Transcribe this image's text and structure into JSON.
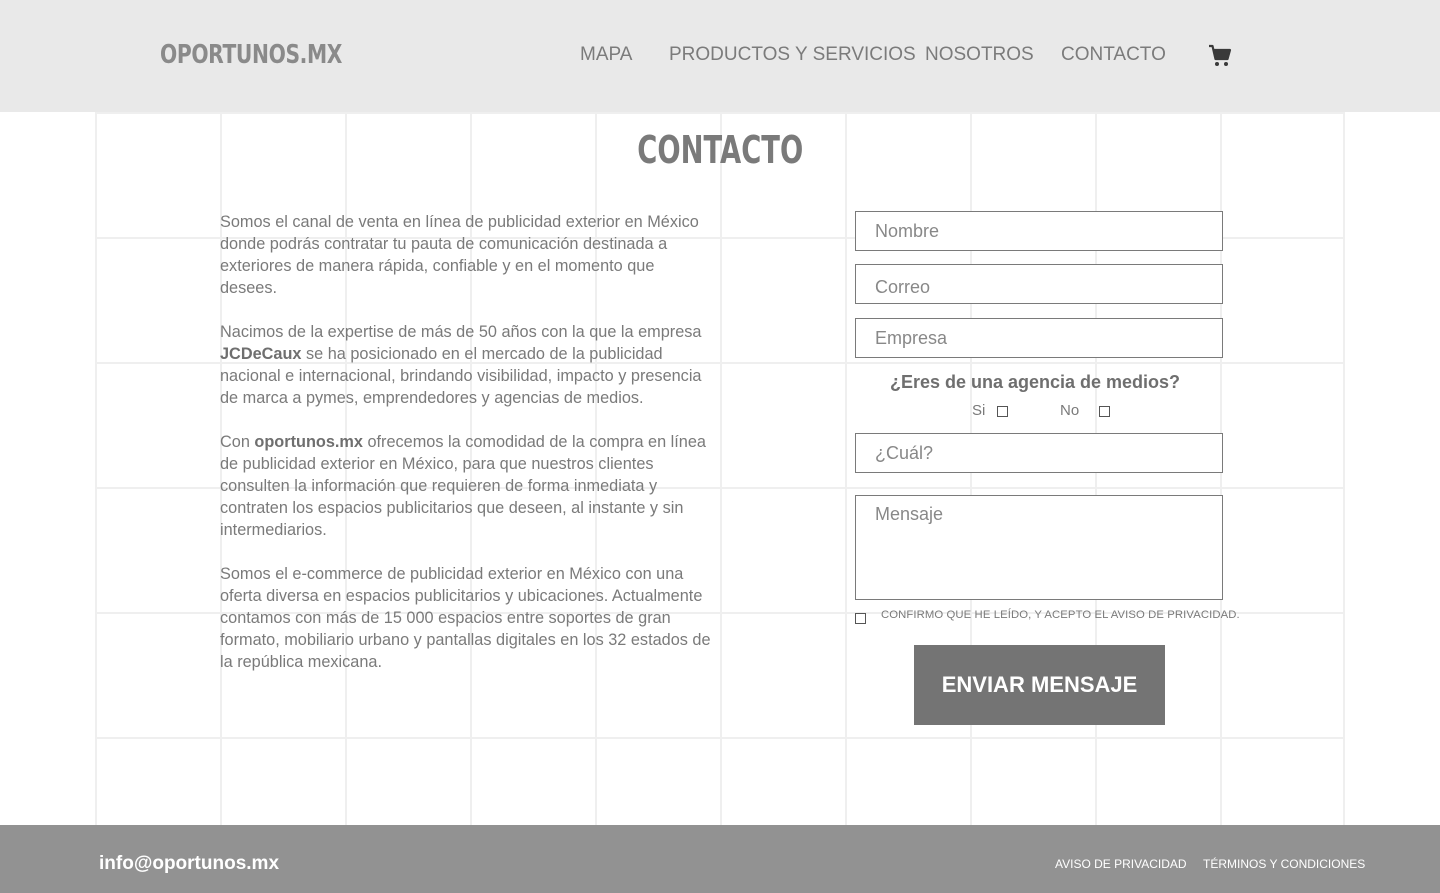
{
  "header": {
    "logo": "OPORTUNOS.MX",
    "nav": [
      "MAPA",
      "PRODUCTOS Y SERVICIOS",
      "NOSOTROS",
      "CONTACTO"
    ],
    "cart_icon": "shopping-cart-icon"
  },
  "page_title": "CONTACTO",
  "intro": {
    "p1": "Somos el canal de venta en línea de publicidad exterior en México donde podrás contratar tu pauta de comunicación destinada a exteriores de manera rápida, confiable y en el momento que desees.",
    "p2_before": "Nacimos de la expertise de más de 50 años con la que la empresa ",
    "p2_bold": "JCDeCaux",
    "p2_after": " se ha posicionado en el mercado de la publicidad nacional e internacional, brindando visibilidad, impacto y presencia de marca a pymes, emprendedores y agencias de medios.",
    "p3_before": "Con ",
    "p3_bold": "oportunos.mx",
    "p3_after": " ofrecemos la comodidad de la compra en línea de publicidad exterior en México, para que nuestros clientes consulten la información que requieren de forma inmediata y contraten los espacios publicitarios que deseen, al instante y sin intermediarios.",
    "p4": "Somos el e-commerce de publicidad exterior en México con una oferta diversa en espacios publicitarios y ubicaciones. Actualmente contamos con más de 15 000 espacios entre soportes de gran formato, mobiliario urbano y pantallas digitales en los 32 estados de la república mexicana."
  },
  "form": {
    "name_placeholder": "Nombre",
    "email_placeholder": "Correo",
    "company_placeholder": "Empresa",
    "agency_question": "¿Eres de una agencia de medios?",
    "yes_label": "Si",
    "no_label": "No",
    "which_placeholder": "¿Cuál?",
    "message_placeholder": "Mensaje",
    "consent_text": "CONFIRMO QUE HE LEÍDO, Y ACEPTO EL AVISO DE PRIVACIDAD.",
    "submit_label": "ENVIAR MENSAJE"
  },
  "footer": {
    "email": "info@oportunos.mx",
    "privacy": "AVISO DE PRIVACIDAD",
    "terms": "TÉRMINOS Y CONDICIONES"
  },
  "colors": {
    "header_bg": "#e9e9e9",
    "footer_bg": "#929292",
    "button_bg": "#747474"
  }
}
